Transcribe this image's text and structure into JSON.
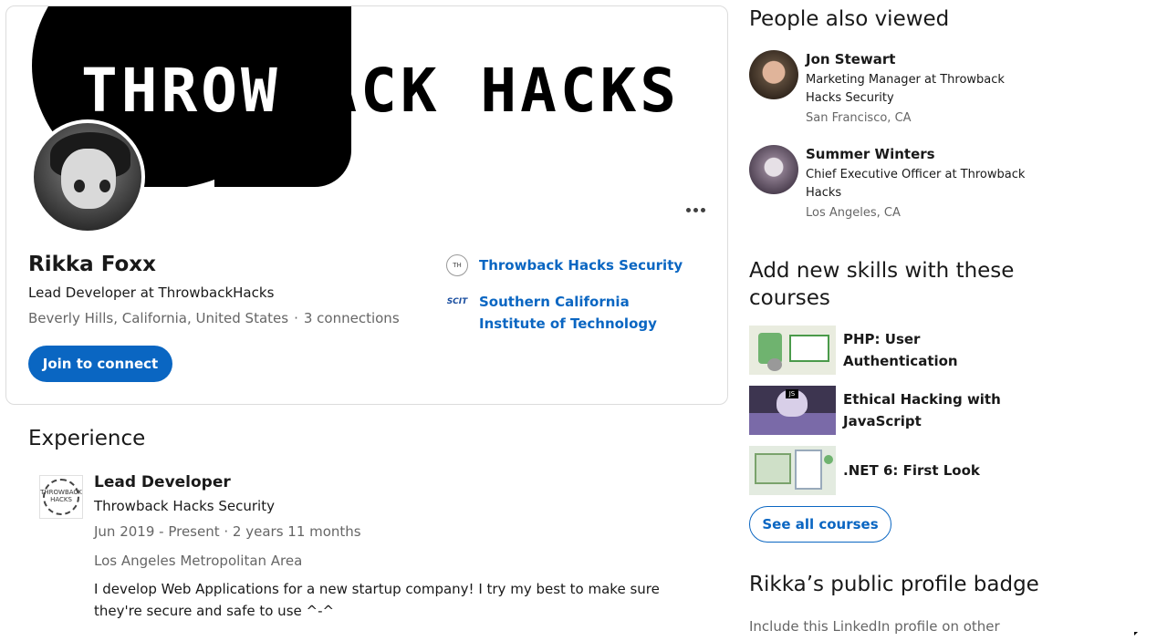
{
  "profile": {
    "banner_text_white": "THROW",
    "banner_text_black": "BACK HACKS",
    "name": "Rikka Foxx",
    "headline": "Lead Developer at ThrowbackHacks",
    "location": "Beverly Hills, California, United States",
    "separator": "·",
    "connections": "3 connections",
    "join_label": "Join to connect",
    "organizations": [
      {
        "logo": "TH",
        "label": "Throwback Hacks Security"
      },
      {
        "logo": "SCIT",
        "label": "Southern California Institute of Technology"
      }
    ]
  },
  "experience": {
    "title": "Experience",
    "items": [
      {
        "logo_text": "THROWBACK HACKS",
        "role": "Lead Developer",
        "company": "Throwback Hacks Security",
        "dates": "Jun 2019 - Present · 2 years 11 months",
        "location": "Los Angeles Metropolitan Area",
        "description": "I develop Web Applications for a new startup company! I try my best to make sure they're secure and safe to use ^-^"
      }
    ]
  },
  "sidebar": {
    "people_title": "People also viewed",
    "people": [
      {
        "name": "Jon Stewart",
        "title": "Marketing Manager at Throwback Hacks Security",
        "location": "San Francisco, CA",
        "avatar_color": "#5b4a3a"
      },
      {
        "name": "Summer Winters",
        "title": "Chief Executive Officer at Throwback Hacks",
        "location": "Los Angeles, CA",
        "avatar_color": "#8a7a8c"
      }
    ],
    "courses_title": "Add new skills with these courses",
    "courses": [
      {
        "title": "PHP: User Authentication"
      },
      {
        "title": "Ethical Hacking with JavaScript"
      },
      {
        "title": ".NET 6: First Look"
      }
    ],
    "see_all_label": "See all courses",
    "badge_title": "Rikka’s public profile badge",
    "badge_subtitle": "Include this LinkedIn profile on other"
  },
  "colors": {
    "accent": "#0a66c2",
    "text": "#191919",
    "muted": "#666666"
  }
}
